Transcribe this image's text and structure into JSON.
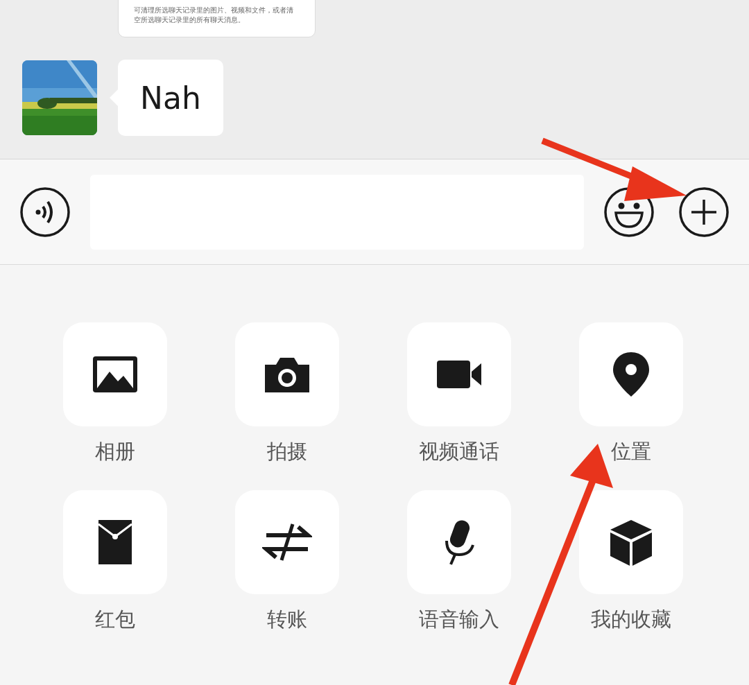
{
  "chat": {
    "card": {
      "description": "可清理所选聊天记录里的图片、视频和文件，或者清空所选聊天记录里的所有聊天消息。"
    },
    "messages": [
      {
        "kind": "picture",
        "text": "Nah"
      }
    ]
  },
  "actions": [
    {
      "kind": "album",
      "label": "相册"
    },
    {
      "kind": "camera",
      "label": "拍摄"
    },
    {
      "kind": "video",
      "label": "视频通话"
    },
    {
      "kind": "location",
      "label": "位置"
    },
    {
      "kind": "redpacket",
      "label": "红包"
    },
    {
      "kind": "transfer",
      "label": "转账"
    },
    {
      "kind": "mic",
      "label": "语音输入"
    },
    {
      "kind": "favorites",
      "label": "我的收藏"
    }
  ]
}
